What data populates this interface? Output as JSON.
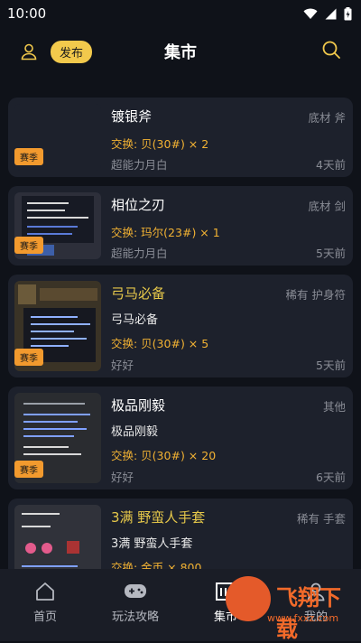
{
  "status": {
    "time": "10:00"
  },
  "header": {
    "publish_label": "发布",
    "title": "集市"
  },
  "items": [
    {
      "name": "镀银斧",
      "category": "底材 斧",
      "desc": "",
      "trade": "交换: 贝(30#) × 2",
      "user": "超能力月白",
      "time": "4天前",
      "season": "赛季",
      "gold": false
    },
    {
      "name": "相位之刃",
      "category": "底材 剑",
      "desc": "",
      "trade": "交换: 玛尔(23#) × 1",
      "user": "超能力月白",
      "time": "5天前",
      "season": "赛季",
      "gold": false
    },
    {
      "name": "弓马必备",
      "category": "稀有 护身符",
      "desc": "弓马必备",
      "trade": "交换: 贝(30#) × 5",
      "user": "好好",
      "time": "5天前",
      "season": "赛季",
      "gold": true
    },
    {
      "name": "极品刚毅",
      "category": "其他",
      "desc": "极品刚毅",
      "trade": "交换: 贝(30#) × 20",
      "user": "好好",
      "time": "6天前",
      "season": "赛季",
      "gold": false
    },
    {
      "name": "3满 野蛮人手套",
      "category": "稀有 手套",
      "desc": "3满 野蛮人手套",
      "trade": "交换: 金币 × 800",
      "user": "",
      "time": "",
      "season": "",
      "gold": true
    }
  ],
  "tabs": [
    {
      "label": "首页",
      "icon": "home-icon"
    },
    {
      "label": "玩法攻略",
      "icon": "gamepad-icon"
    },
    {
      "label": "集市",
      "icon": "market-icon"
    },
    {
      "label": "我的",
      "icon": "user-icon"
    }
  ],
  "watermark": {
    "text": "飞翔下载",
    "url": "www.fxxz.com"
  }
}
